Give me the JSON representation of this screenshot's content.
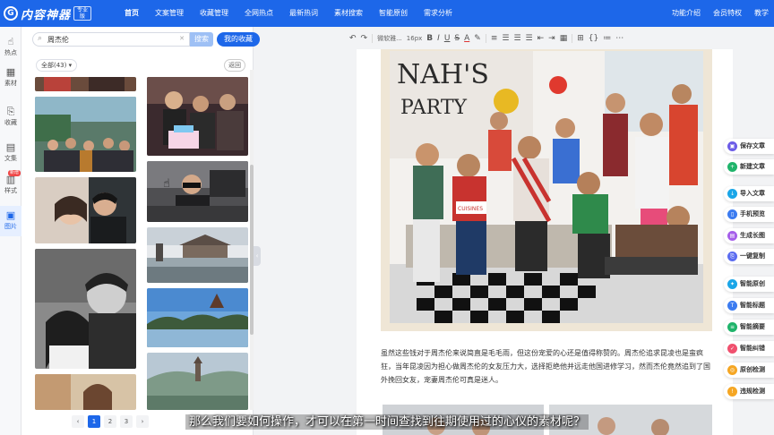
{
  "app": {
    "logo_mark": "G",
    "logo_text": "内容神器",
    "logo_badge": "专业版"
  },
  "nav": {
    "items": [
      "首页",
      "文案管理",
      "收藏管理",
      "全网热点",
      "最新热词",
      "素材搜索",
      "智能原创",
      "需求分析"
    ],
    "right": [
      "功能介绍",
      "会员特权",
      "教学"
    ]
  },
  "rail": {
    "items": [
      {
        "icon": "☝",
        "label": "热点",
        "icon_name": "hand-icon"
      },
      {
        "icon": "▦",
        "label": "素材",
        "icon_name": "material-icon"
      },
      {
        "icon": "⎘",
        "label": "收藏",
        "icon_name": "collect-icon"
      },
      {
        "icon": "▤",
        "label": "文集",
        "icon_name": "collection-icon"
      },
      {
        "icon": "▥",
        "label": "样式",
        "icon_name": "style-icon",
        "badge": "新增"
      },
      {
        "icon": "▣",
        "label": "图片",
        "icon_name": "image-icon"
      }
    ]
  },
  "panel": {
    "search_value": "周杰伦",
    "search_button": "搜索",
    "favorites_button": "我的收藏",
    "filter_label": "全部(43) ▾",
    "back_button": "返回",
    "pages": [
      "‹",
      "1",
      "2",
      "3",
      "›"
    ]
  },
  "toolbar": {
    "font": "微软雅...",
    "size": "16px",
    "buttons": [
      "B",
      "I",
      "U",
      "S",
      "A",
      "≡",
      "⇤",
      "⇥",
      "▦",
      "⊞",
      "{}",
      "≔",
      "⋯"
    ]
  },
  "editor": {
    "body": "虽然这些钱对于周杰伦来说简直是毛毛雨，但这份宠爱的心还是值得称赞的。周杰伦追求昆凌也是蛮疯狂，当年昆凌因为担心做周杰伦的女友压力大，选择拒绝他并远走他国进修学习，然而杰伦竟然追到了国外挽回女友，宠妻周杰伦可真是迷人。",
    "photo_sign": "NAH'S PARTY",
    "shirt_text": "CUISINES PABEC"
  },
  "side_buttons": [
    {
      "label": "保存文章",
      "color": "#6c5ce7"
    },
    {
      "label": "新建文章",
      "color": "#20b46b"
    },
    {
      "label": "导入文章",
      "color": "#1aa6e8"
    },
    {
      "label": "手机预览",
      "color": "#3b7bf0"
    },
    {
      "label": "生成长图",
      "color": "#a55eea"
    },
    {
      "label": "一键复制",
      "color": "#5b6cf0"
    },
    {
      "label": "智能原创",
      "color": "#1aa6e8"
    },
    {
      "label": "智能标题",
      "color": "#3b7bf0"
    },
    {
      "label": "智能摘要",
      "color": "#20b46b"
    },
    {
      "label": "智能纠错",
      "color": "#f0506e"
    },
    {
      "label": "原创检测",
      "color": "#f5a623"
    },
    {
      "label": "违规检测",
      "color": "#f5a623"
    }
  ],
  "subtitle": "那么我们要如何操作，才可以在第一时间查找到往期使用过的心仪的素材呢？"
}
